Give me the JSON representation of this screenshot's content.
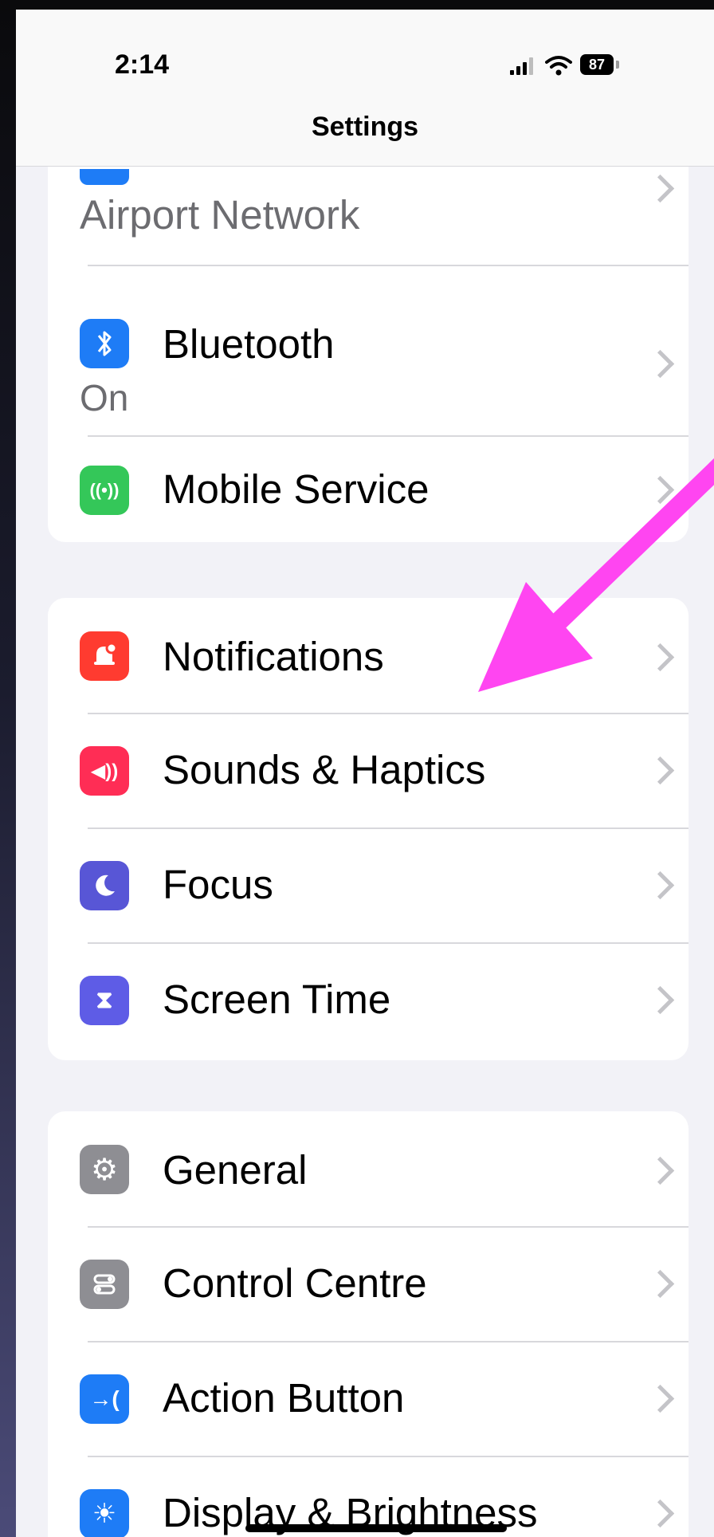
{
  "status_bar": {
    "time": "2:14",
    "battery": "87"
  },
  "nav": {
    "title": "Settings"
  },
  "rows": {
    "airport": {
      "label": "Airport Network"
    },
    "bluetooth": {
      "label": "Bluetooth",
      "value": "On"
    },
    "mobile": {
      "label": "Mobile Service"
    },
    "notifications": {
      "label": "Notifications"
    },
    "sounds": {
      "label": "Sounds & Haptics"
    },
    "focus": {
      "label": "Focus"
    },
    "screentime": {
      "label": "Screen Time"
    },
    "general": {
      "label": "General"
    },
    "control": {
      "label": "Control Centre"
    },
    "action": {
      "label": "Action Button"
    },
    "display": {
      "label": "Display & Brightness"
    }
  },
  "icons": {
    "bluetooth": "bluetooth-icon",
    "mobile": "antenna-icon",
    "notifications": "bell-icon",
    "sounds": "speaker-icon",
    "focus": "moon-icon",
    "screentime": "hourglass-icon",
    "general": "gear-icon",
    "control": "toggles-icon",
    "action": "action-button-icon",
    "display": "sun-icon"
  },
  "colors": {
    "blue": "#1e7cf6",
    "green": "#34c759",
    "red": "#ff3b30",
    "pink": "#ff2d55",
    "indigo": "#5856d6",
    "purple": "#5e5ce6",
    "gray": "#8e8e93",
    "annotation": "#ff45f1"
  }
}
